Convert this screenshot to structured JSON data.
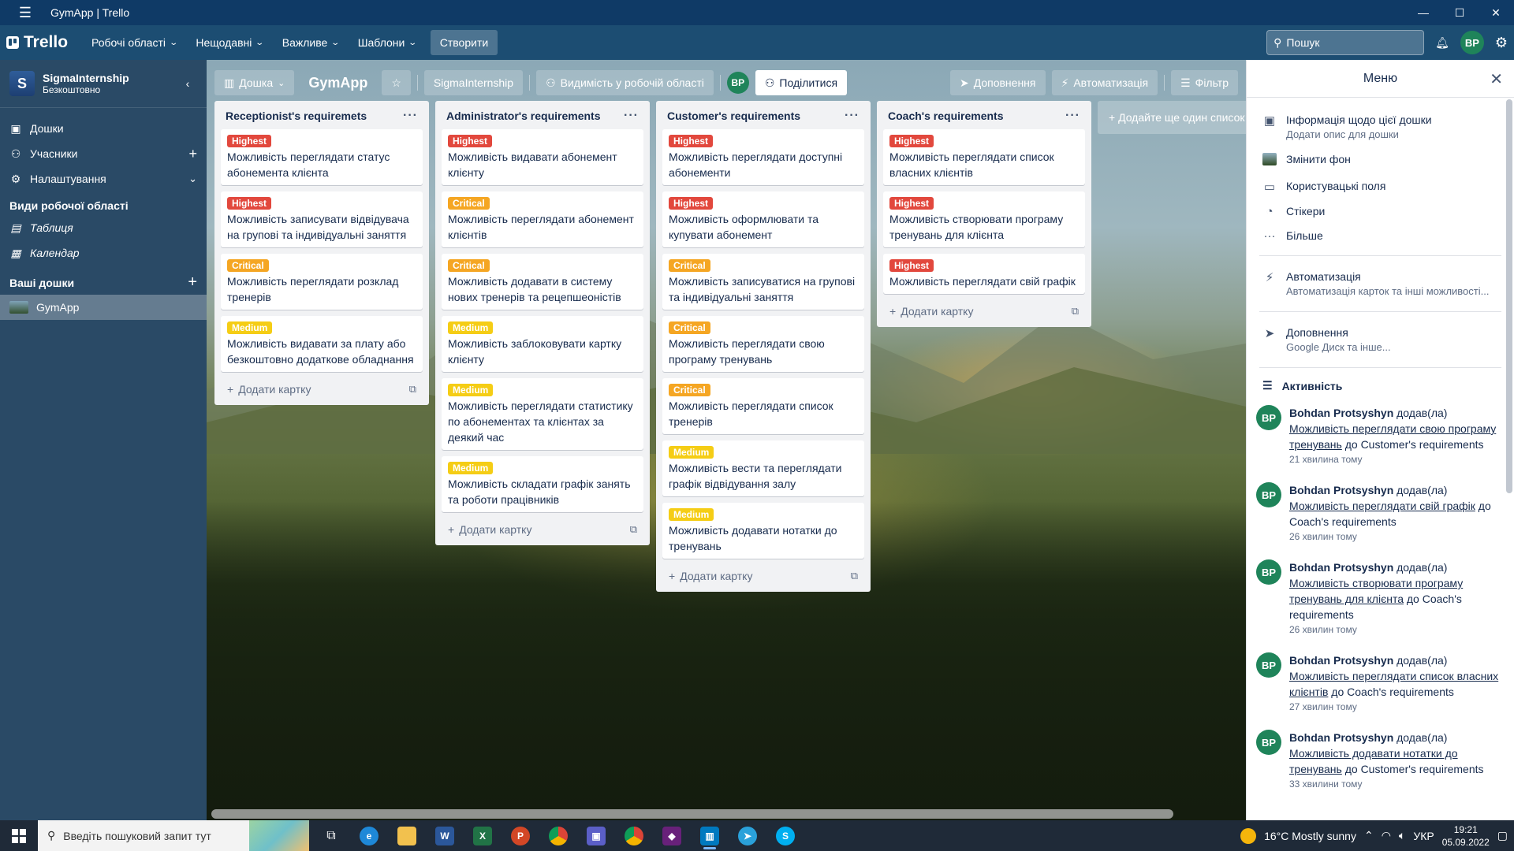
{
  "window": {
    "title": "GymApp | Trello"
  },
  "topnav": {
    "logo": "Trello",
    "items": [
      {
        "label": "Робочі області"
      },
      {
        "label": "Нещодавні"
      },
      {
        "label": "Важливе"
      },
      {
        "label": "Шаблони"
      }
    ],
    "create": "Створити",
    "search_placeholder": "Пошук",
    "avatar": "BP"
  },
  "sidebar": {
    "workspace_initial": "S",
    "workspace_name": "SigmaInternship",
    "workspace_plan": "Безкоштовно",
    "items": [
      {
        "label": "Дошки"
      },
      {
        "label": "Учасники"
      },
      {
        "label": "Налаштування"
      }
    ],
    "views_header": "Види робочої області",
    "views": [
      {
        "label": "Таблиця"
      },
      {
        "label": "Календар"
      }
    ],
    "boards_header": "Ваші дошки",
    "boards": [
      {
        "label": "GymApp"
      }
    ]
  },
  "board": {
    "view_label": "Дошка",
    "title": "GymApp",
    "workspace": "SigmaInternship",
    "visibility": "Видимість у робочій області",
    "member": "BP",
    "share": "Поділитися",
    "powerups": "Доповнення",
    "automation": "Автоматизація",
    "filter": "Фільтр",
    "add_list": "+ Додайте ще один список",
    "add_card": "Додати картку",
    "lists": [
      {
        "title": "Receptionist's requiremets",
        "cards": [
          {
            "label": "Highest",
            "text": "Можливість переглядати статус абонемента клієнта"
          },
          {
            "label": "Highest",
            "text": "Можливість записувати відвідувача на групові та індивідуальні заняття"
          },
          {
            "label": "Critical",
            "text": "Можливість переглядати розклад тренерів"
          },
          {
            "label": "Medium",
            "text": "Можливість видавати за плату або безкоштовно додаткове обладнання"
          }
        ]
      },
      {
        "title": "Administrator's requirements",
        "cards": [
          {
            "label": "Highest",
            "text": "Можливість видавати абонемент клієнту"
          },
          {
            "label": "Critical",
            "text": "Можливість переглядати абонемент клієнтів"
          },
          {
            "label": "Critical",
            "text": "Можливість додавати в систему нових тренерів та рецепшеоністів"
          },
          {
            "label": "Medium",
            "text": "Можливість заблоковувати картку клієнту"
          },
          {
            "label": "Medium",
            "text": "Можливість переглядати статистику по абонементах та клієнтах за деякий час"
          },
          {
            "label": "Medium",
            "text": "Можливість складати графік занять та роботи працівників"
          }
        ]
      },
      {
        "title": "Customer's requirements",
        "cards": [
          {
            "label": "Highest",
            "text": "Можливість переглядати доступні абонементи"
          },
          {
            "label": "Highest",
            "text": "Можливість оформлювати та купувати абонемент"
          },
          {
            "label": "Critical",
            "text": "Можливість записуватися на групові та індивідуальні заняття"
          },
          {
            "label": "Critical",
            "text": "Можливість переглядати свою програму тренувань"
          },
          {
            "label": "Critical",
            "text": "Можливість переглядати список тренерів"
          },
          {
            "label": "Medium",
            "text": "Можливість вести та переглядати графік відвідування залу"
          },
          {
            "label": "Medium",
            "text": "Можливість додавати нотатки до тренувань"
          }
        ]
      },
      {
        "title": "Coach's requirements",
        "cards": [
          {
            "label": "Highest",
            "text": "Можливість переглядати список власних клієнтів"
          },
          {
            "label": "Highest",
            "text": "Можливість створювати програму тренувань для клієнта"
          },
          {
            "label": "Highest",
            "text": "Можливість переглядати свій графік"
          }
        ]
      }
    ]
  },
  "menu": {
    "title": "Меню",
    "items": [
      {
        "title": "Інформація щодо цієї дошки",
        "sub": "Додати опис для дошки",
        "icon": "board-icon"
      },
      {
        "title": "Змінити фон",
        "sub": "",
        "icon": "background-thumb-icon"
      },
      {
        "title": "Користувацькі поля",
        "sub": "",
        "icon": "custom-fields-icon"
      },
      {
        "title": "Стікери",
        "sub": "",
        "icon": "sticker-icon"
      },
      {
        "title": "Більше",
        "sub": "",
        "icon": "more-icon"
      }
    ],
    "automation": {
      "title": "Автоматизація",
      "sub": "Автоматизація карток та інші можливості..."
    },
    "powerups": {
      "title": "Доповнення",
      "sub": "Google Диск та інше..."
    },
    "activity_header": "Активність",
    "activity": [
      {
        "user": "Bohdan Protsyshyn",
        "verb": "додав(ла)",
        "link": "Можливість переглядати свою програму тренувань",
        "prep": "до",
        "target": "Customer's requirements",
        "time": "21 хвилина тому"
      },
      {
        "user": "Bohdan Protsyshyn",
        "verb": "додав(ла)",
        "link": "Можливість переглядати свій графік",
        "prep": "до",
        "target": "Coach's requirements",
        "time": "26 хвилин тому"
      },
      {
        "user": "Bohdan Protsyshyn",
        "verb": "додав(ла)",
        "link": "Можливість створювати програму тренувань для клієнта",
        "prep": "до",
        "target": "Coach's requirements",
        "time": "26 хвилин тому"
      },
      {
        "user": "Bohdan Protsyshyn",
        "verb": "додав(ла)",
        "link": "Можливість переглядати список власних клієнтів",
        "prep": "до",
        "target": "Coach's requirements",
        "time": "27 хвилин тому"
      },
      {
        "user": "Bohdan Protsyshyn",
        "verb": "додав(ла)",
        "link": "Можливість додавати нотатки до тренувань",
        "prep": "до",
        "target": "Customer's requirements",
        "time": "33 хвилини тому"
      }
    ],
    "avatar": "BP"
  },
  "taskbar": {
    "search_placeholder": "Введіть пошуковий запит тут",
    "weather": "16°C  Mostly sunny",
    "lang": "УКР",
    "time": "19:21",
    "date": "05.09.2022"
  },
  "colors": {
    "highest": "#e2483d",
    "critical": "#f5a623",
    "medium": "#f5cd15",
    "avatar": "#1f845a"
  }
}
